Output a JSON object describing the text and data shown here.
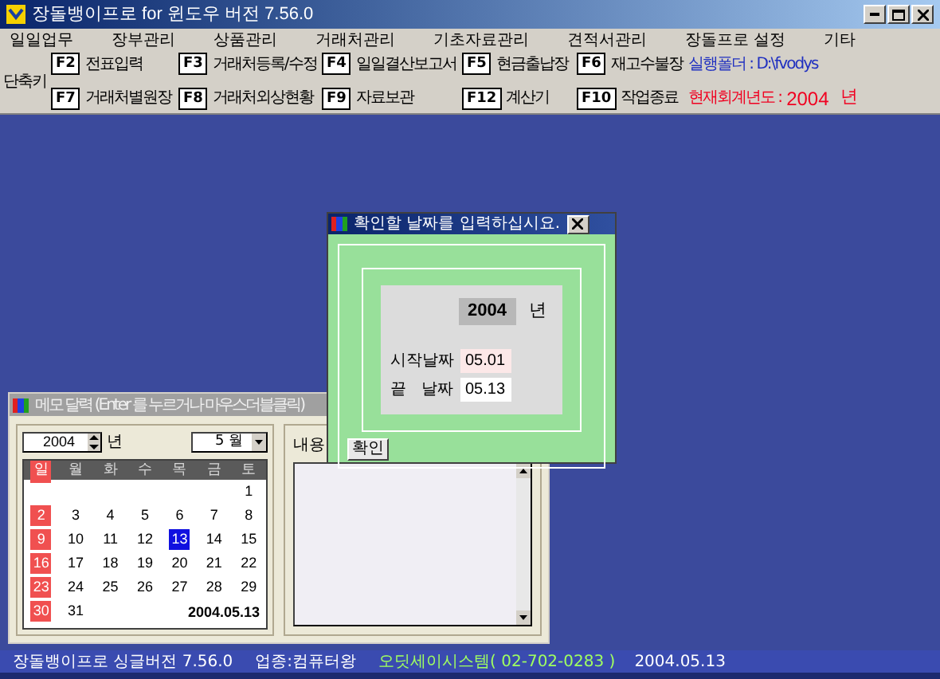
{
  "window": {
    "title": "장돌뱅이프로 for 윈도우 버전 7.56.0"
  },
  "menu": [
    "일일업무",
    "장부관리",
    "상품관리",
    "거래처관리",
    "기초자료관리",
    "견적서관리",
    "장돌프로 설정",
    "기타"
  ],
  "shortcuts": {
    "label": "단축키",
    "rows": [
      [
        {
          "key": "F2",
          "label": "전표입력"
        },
        {
          "key": "F3",
          "label": "거래처등록/수정"
        },
        {
          "key": "F4",
          "label": "일일결산보고서"
        },
        {
          "key": "F5",
          "label": "현금출납장"
        },
        {
          "key": "F6",
          "label": "재고수불장"
        }
      ],
      [
        {
          "key": "F7",
          "label": "거래처별원장"
        },
        {
          "key": "F8",
          "label": "거래처외상현황"
        },
        {
          "key": "F9",
          "label": "자료보관"
        },
        {
          "key": "F12",
          "label": "계산기"
        },
        {
          "key": "F10",
          "label": "작업종료"
        }
      ]
    ],
    "folder": "실행폴더 : D:\\fvodys",
    "fiscal_label": "현재회계년도 :",
    "fiscal_year": "2004",
    "fiscal_unit": "년"
  },
  "memo_window": {
    "title": "메모 달력 (Enter 를 누르거나 마우스더블클릭)",
    "year": "2004",
    "year_unit": "년",
    "month": "5 월",
    "weekdays": [
      "일",
      "월",
      "화",
      "수",
      "목",
      "금",
      "토"
    ],
    "weeks": [
      {
        "sat": {
          "day": "1",
          "selected": false
        }
      },
      {
        "sun": {
          "day": "2",
          "selected": false
        },
        "mon": {
          "day": "3",
          "selected": false
        },
        "tue": {
          "day": "4",
          "selected": false
        },
        "wed": {
          "day": "5",
          "selected": false
        },
        "thu": {
          "day": "6",
          "selected": false
        },
        "fri": {
          "day": "7",
          "selected": false
        },
        "sat": {
          "day": "8",
          "selected": false
        }
      },
      {
        "sun": {
          "day": "9",
          "selected": false
        },
        "mon": {
          "day": "10",
          "selected": false
        },
        "tue": {
          "day": "11",
          "selected": false
        },
        "wed": {
          "day": "12",
          "selected": false
        },
        "thu": {
          "day": "13",
          "selected": true
        },
        "fri": {
          "day": "14",
          "selected": false
        },
        "sat": {
          "day": "15",
          "selected": false
        }
      },
      {
        "sun": {
          "day": "16",
          "selected": false
        },
        "mon": {
          "day": "17",
          "selected": false
        },
        "tue": {
          "day": "18",
          "selected": false
        },
        "wed": {
          "day": "19",
          "selected": false
        },
        "thu": {
          "day": "20",
          "selected": false
        },
        "fri": {
          "day": "21",
          "selected": false
        },
        "sat": {
          "day": "22",
          "selected": false
        }
      },
      {
        "sun": {
          "day": "23",
          "selected": false
        },
        "mon": {
          "day": "24",
          "selected": false
        },
        "tue": {
          "day": "25",
          "selected": false
        },
        "wed": {
          "day": "26",
          "selected": false
        },
        "thu": {
          "day": "27",
          "selected": false
        },
        "fri": {
          "day": "28",
          "selected": false
        },
        "sat": {
          "day": "29",
          "selected": false
        }
      },
      {
        "sun": {
          "day": "30",
          "selected": false
        },
        "mon": {
          "day": "31",
          "selected": false
        }
      }
    ],
    "date": "2004.05.13",
    "content_label": "내용"
  },
  "dialog": {
    "title": "확인할 날짜를 입력하십시요.",
    "year": "2004",
    "year_unit": "년",
    "start_label": "시작날짜",
    "start_value": "05.01",
    "end_label": "끝   날짜",
    "end_value": "05.13",
    "button": "확인"
  },
  "status_bar": {
    "product": "장돌뱅이프로 싱글버전 7.56.0",
    "industry": "업종:컴퓨터왕",
    "company": "오딧세이시스템( 02-702-0283 )",
    "date": "2004.05.13"
  }
}
